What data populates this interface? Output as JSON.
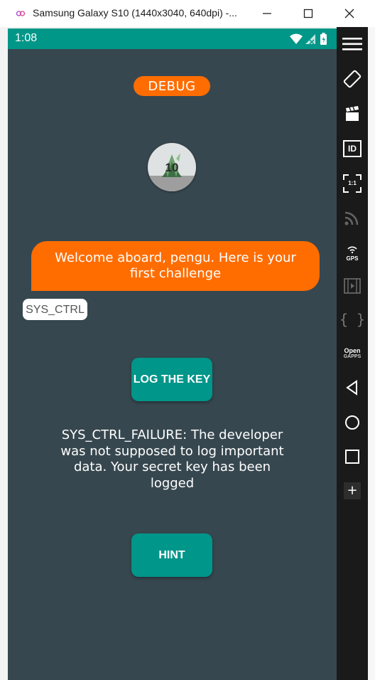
{
  "window": {
    "title": "Samsung Galaxy S10 (1440x3040, 640dpi) -..."
  },
  "statusbar": {
    "time": "1:08"
  },
  "app": {
    "debug_label": "DEBUG",
    "avatar_number": "10",
    "welcome_message": "Welcome aboard, pengu. Here is your first challenge",
    "challenge_tag": "SYS_CTRL",
    "log_button": "LOG THE KEY",
    "result_message": "SYS_CTRL_FAILURE: The developer was not supposed to log important data. Your secret key has been logged",
    "hint_button": "HINT"
  },
  "toolbar": {
    "items": [
      "menu-icon",
      "rotate-icon",
      "screenshot-icon",
      "id-icon",
      "resize-icon",
      "cast-icon",
      "gps-icon",
      "media-icon",
      "code-icon",
      "opengapps-icon",
      "back-icon",
      "home-icon",
      "overview-icon"
    ],
    "id_label": "ID",
    "scale_label": "1:1",
    "gps_label": "GPS",
    "open_label": "Open",
    "gapps_label": "GAPPS",
    "code_label": "{ }",
    "plus_label": "+"
  },
  "colors": {
    "status_bar": "#009688",
    "screen_bg": "#37474f",
    "accent_orange": "#ff6d00",
    "button_teal": "#00968a",
    "toolbar_bg": "#1a1a1a"
  }
}
